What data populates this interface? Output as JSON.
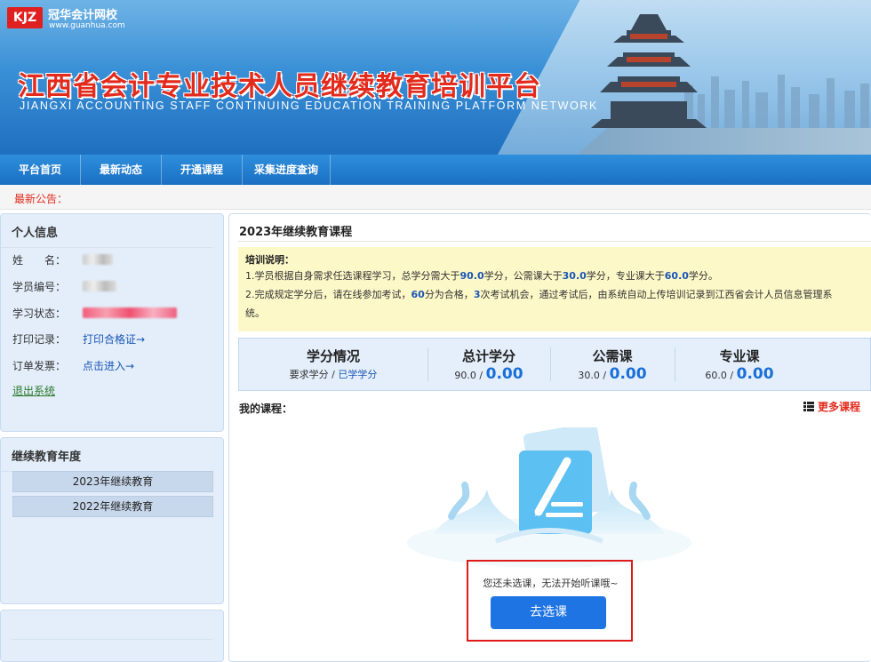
{
  "header": {
    "logo_box": "KJZ",
    "logo_name": "冠华会计网校",
    "logo_url": "www.guanhua.com",
    "title": "江西省会计专业技术人员继续教育培训平台",
    "subtitle": "JIANGXI ACCOUNTING STAFF CONTINUING EDUCATION TRAINING PLATFORM NETWORK"
  },
  "nav": {
    "items": [
      {
        "label": "平台首页"
      },
      {
        "label": "最新动态"
      },
      {
        "label": "开通课程"
      },
      {
        "label": "采集进度查询"
      }
    ]
  },
  "notice_bar": {
    "label": "最新公告："
  },
  "profile": {
    "title": "个人信息",
    "name_label": "姓　　名：",
    "id_label": "学员编号：",
    "status_label": "学习状态：",
    "print_label": "打印记录：",
    "print_link": "打印合格证→",
    "invoice_label": "订单发票：",
    "invoice_link": "点击进入→",
    "logout": "退出系统"
  },
  "years": {
    "title": "继续教育年度",
    "items": [
      {
        "label": "2023年继续教育"
      },
      {
        "label": "2022年继续教育"
      }
    ]
  },
  "main": {
    "title": "2023年继续教育课程",
    "notice_title": "培训说明：",
    "line1": {
      "a": "1.学员根据自身需求任选课程学习，总学分需大于",
      "v1": "90.0",
      "b": "学分，公需课大于",
      "v2": "30.0",
      "c": "学分，专业课大于",
      "v3": "60.0",
      "d": "学分。"
    },
    "line2": {
      "a": "2.完成规定学分后，请在线参加考试，",
      "v1": "60",
      "b": "分为合格，",
      "v2": "3",
      "c": "次考试机会，通过考试后，由系统自动上传培训记录到江西省会计人员信息管理系",
      "d": "统。"
    },
    "credits": {
      "summary_title": "学分情况",
      "summary_req": "要求学分",
      "summary_sep": " / ",
      "summary_done": "已学学分",
      "cols": [
        {
          "title": "总计学分",
          "required": "90.0",
          "earned": "0.00"
        },
        {
          "title": "公需课",
          "required": "30.0",
          "earned": "0.00"
        },
        {
          "title": "专业课",
          "required": "60.0",
          "earned": "0.00"
        }
      ],
      "slash": " / "
    },
    "my_courses": "我的课程：",
    "more_courses": "更多课程",
    "empty_text": "您还未选课，无法开始听课哦~",
    "go_button": "去选课"
  },
  "colors": {
    "accent": "#1f74e4",
    "title_red": "#e22b1d",
    "highlight_blue": "#1a55b5"
  }
}
